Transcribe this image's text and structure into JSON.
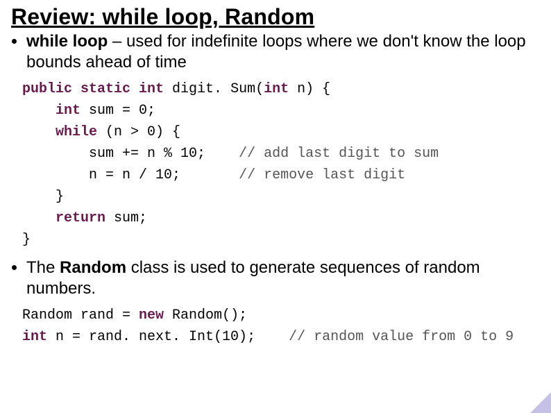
{
  "title": "Review: while loop, Random",
  "bullets": {
    "first": {
      "strong": "while loop",
      "rest": " – used for indefinite loops where we don't know the loop bounds ahead of time"
    },
    "second": {
      "pre": "The ",
      "strong": "Random",
      "rest": " class is used to generate sequences of random numbers."
    }
  },
  "code1": {
    "kw_sig": "public static int",
    "sig_after": " digit. Sum(",
    "kw_param": "int",
    "sig_end": " n) {",
    "l2a": "    ",
    "kw_int": "int",
    "l2b": " sum = 0;",
    "l3a": "    ",
    "kw_while": "while",
    "l3b": " (n > 0) {",
    "l4": "        sum += n % 10;    ",
    "c4": "// add last digit to sum",
    "l5": "        n = n / 10;       ",
    "c5": "// remove last digit",
    "l6": "    }",
    "l7a": "    ",
    "kw_return": "return",
    "l7b": " sum;",
    "l8": "}"
  },
  "code2": {
    "l1a": "Random rand = ",
    "kw_new": "new",
    "l1b": " Random();",
    "l2a": "",
    "kw_int": "int",
    "l2b": " n = rand. next. Int(10);    ",
    "c2": "// random value from 0 to 9"
  }
}
